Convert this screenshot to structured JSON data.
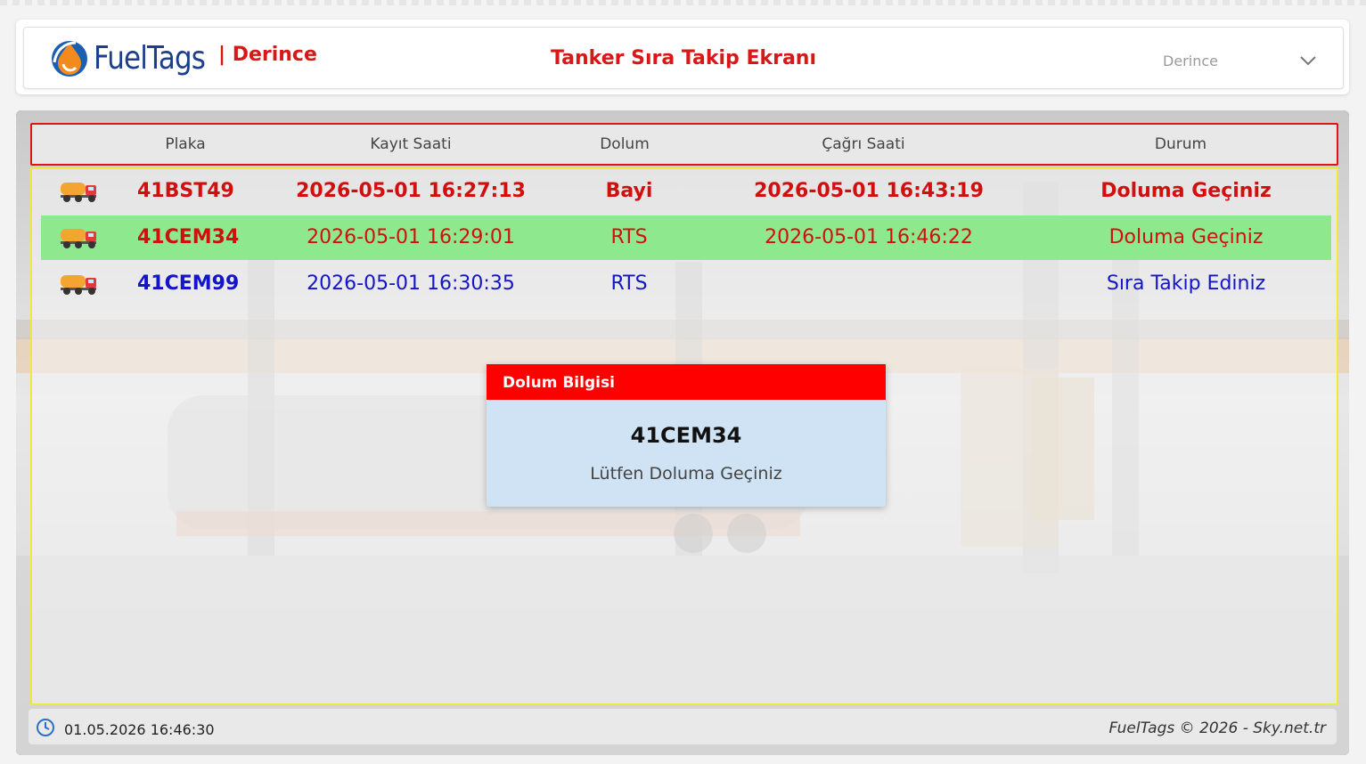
{
  "brand": {
    "name": "FuelTags",
    "site": "| Derince"
  },
  "page_title": "Tanker Sıra Takip Ekranı",
  "site_select": {
    "value": "Derince"
  },
  "table": {
    "headers": [
      "Plaka",
      "Kayıt Saati",
      "Dolum",
      "Çağrı Saati",
      "Durum"
    ],
    "rows": [
      {
        "plate": "41BST49",
        "registered": "2026-05-01 16:27:13",
        "fill": "Bayi",
        "called": "2026-05-01 16:43:19",
        "status": "Doluma Geçiniz"
      },
      {
        "plate": "41CEM34",
        "registered": "2026-05-01 16:29:01",
        "fill": "RTS",
        "called": "2026-05-01 16:46:22",
        "status": "Doluma Geçiniz"
      },
      {
        "plate": "41CEM99",
        "registered": "2026-05-01 16:30:35",
        "fill": "RTS",
        "called": "",
        "status": "Sıra Takip Ediniz"
      }
    ]
  },
  "popup": {
    "title": "Dolum Bilgisi",
    "plate": "41CEM34",
    "message": "Lütfen Doluma Geçiniz"
  },
  "footer": {
    "datetime": "01.05.2026 16:46:30",
    "copyright": "FuelTags © 2026  - Sky.net.tr"
  },
  "colors": {
    "accent_red": "#d20f0f",
    "queue_blue": "#1414c8",
    "called_row_green": "#8ee88e",
    "popup_header": "#ff0000",
    "brand_blue": "#1c3e8c"
  },
  "icons": {
    "truck": "tanker-truck-icon",
    "clock": "clock-icon",
    "dropdown": "chevron-down-icon",
    "logo": "fuel-drop-logo-icon"
  }
}
